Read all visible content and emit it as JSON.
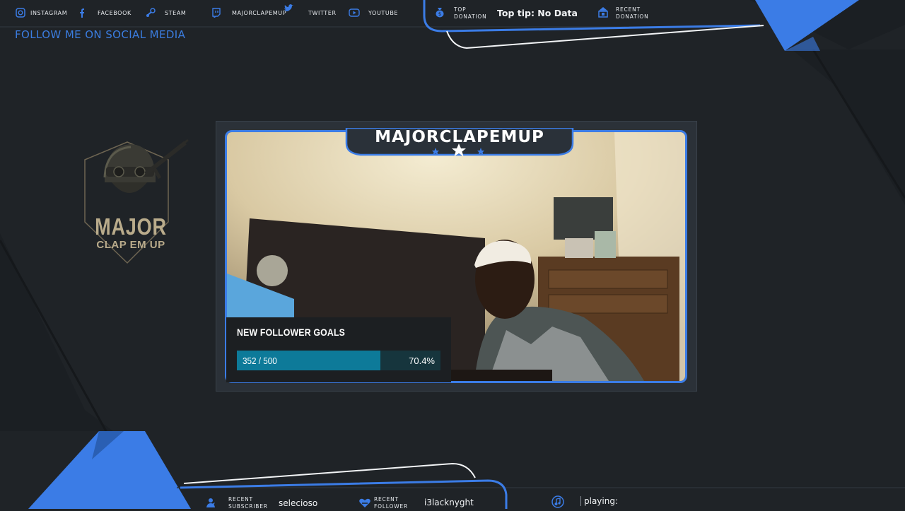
{
  "social": {
    "title": "FOLLOW ME ON SOCIAL MEDIA",
    "items": [
      {
        "label": "INSTAGRAM",
        "icon": "instagram-icon"
      },
      {
        "label": "FACEBOOK",
        "icon": "facebook-icon"
      },
      {
        "label": "STEAM",
        "icon": "steam-icon"
      },
      {
        "label": "MAJORCLAPEMUP",
        "icon": "twitch-icon"
      },
      {
        "label": "TWITTER",
        "icon": "twitter-icon"
      },
      {
        "label": "YOUTUBE",
        "icon": "youtube-icon"
      }
    ]
  },
  "donations": {
    "top_label_1": "TOP",
    "top_label_2": "DONATION",
    "top_value": "Top tip: No Data",
    "recent_label_1": "RECENT",
    "recent_label_2": "DONATION",
    "recent_value": ""
  },
  "webcam": {
    "streamer_name": "MAJORCLAPEMUP"
  },
  "follower_goal": {
    "title": "NEW FOLLOWER GOALS",
    "count_text": "352 / 500",
    "percent_text": "70.4%",
    "progress": 0.704
  },
  "logo": {
    "line1": "MAJOR",
    "line2": "CLAP EM UP"
  },
  "bottom": {
    "subscriber_label_1": "RECENT",
    "subscriber_label_2": "SUBSCRIBER",
    "subscriber_value": "selecioso",
    "follower_label_1": "RECENT",
    "follower_label_2": "FOLLOWER",
    "follower_value": "i3lacknyght",
    "playing_label": "playing:",
    "playing_value": ""
  },
  "colors": {
    "accent": "#3b7ce6",
    "background": "#1f2327",
    "goal_fill": "#0d7a99"
  }
}
